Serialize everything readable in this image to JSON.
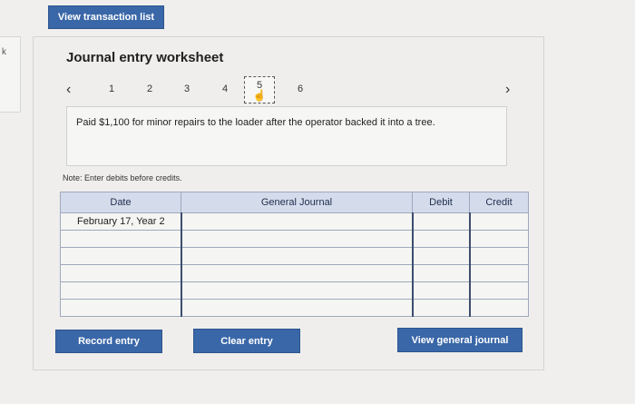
{
  "top_button": "View transaction list",
  "left_mark": "k",
  "worksheet": {
    "title": "Journal entry worksheet",
    "nav": {
      "prev_icon": "‹",
      "next_icon": "›",
      "pages": [
        "1",
        "2",
        "3",
        "4",
        "5",
        "6"
      ],
      "active": "5"
    },
    "description": "Paid $1,100 for minor repairs to the loader after the operator backed it into a tree.",
    "note": "Note: Enter debits before credits.",
    "table": {
      "headers": [
        "Date",
        "General Journal",
        "Debit",
        "Credit"
      ],
      "first_date": "February 17, Year 2"
    },
    "buttons": {
      "record": "Record entry",
      "clear": "Clear entry",
      "view_general_journal": "View general journal"
    }
  },
  "colors": {
    "button_blue": "#3a67a8",
    "header_bg": "#d4dceb"
  }
}
